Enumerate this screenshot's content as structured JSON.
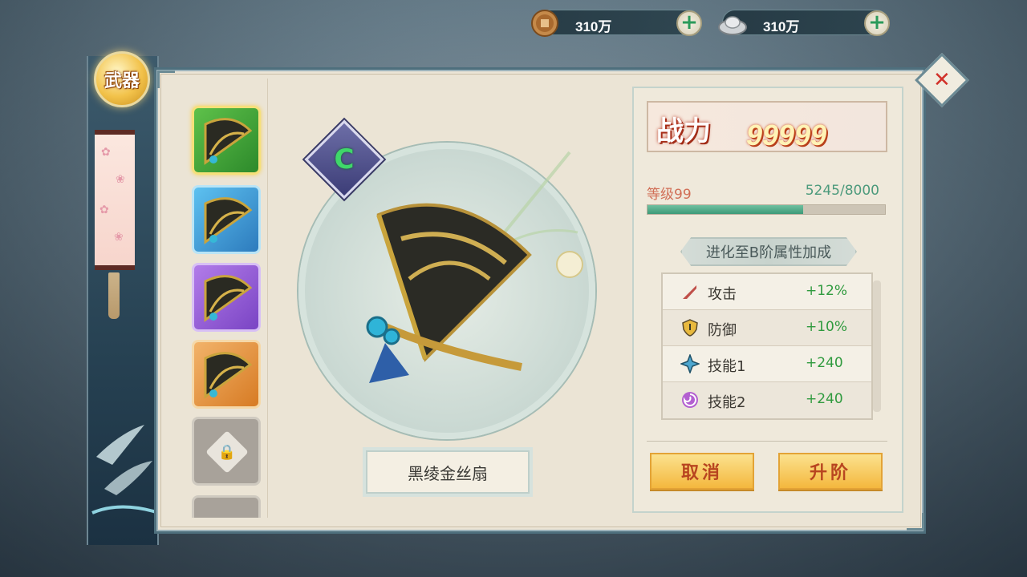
{
  "currency": {
    "copper": {
      "icon": "copper-coin-icon",
      "value": "310万"
    },
    "silver": {
      "icon": "silver-ingot-icon",
      "value": "310万"
    }
  },
  "sidebar": {
    "badge": "武器"
  },
  "weapon_list": {
    "items": [
      {
        "rarity": "green",
        "icon": "fan-weapon-icon"
      },
      {
        "rarity": "blue",
        "icon": "fan-weapon-icon"
      },
      {
        "rarity": "purple",
        "icon": "fan-weapon-icon"
      },
      {
        "rarity": "orange",
        "icon": "fan-weapon-icon"
      },
      {
        "rarity": "locked",
        "icon": "lock-icon"
      }
    ]
  },
  "weapon": {
    "grade": "C",
    "name": "黑绫金丝扇"
  },
  "power": {
    "label": "战力",
    "value": "99999"
  },
  "level": {
    "label": "等级99",
    "exp": "5245/8000",
    "progress": 0.6556
  },
  "evolution": {
    "title": "进化至B阶属性加成",
    "attributes": [
      {
        "name": "攻击",
        "value": "+12%",
        "icon": "sword-icon"
      },
      {
        "name": "防御",
        "value": "+10%",
        "icon": "shield-icon"
      },
      {
        "name": "技能1",
        "value": "+240",
        "icon": "star-skill-icon"
      },
      {
        "name": "技能2",
        "value": "+240",
        "icon": "swirl-skill-icon"
      }
    ]
  },
  "buttons": {
    "cancel": "取消",
    "upgrade": "升阶"
  },
  "colors": {
    "accent": "#f4b83e",
    "frame": "#4e6f7d",
    "positive": "#2f9a3e",
    "power": "#d04a20"
  }
}
